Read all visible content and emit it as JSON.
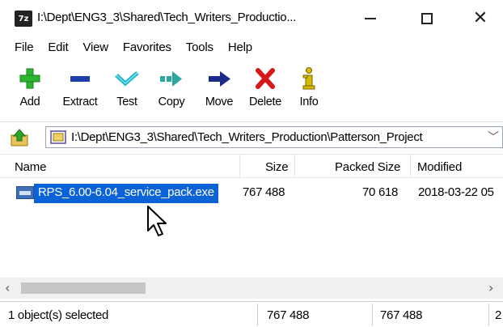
{
  "window": {
    "app_icon_text": "7z",
    "title": "I:\\Dept\\ENG3_3\\Shared\\Tech_Writers_Productio...",
    "minimize_icon": "minimize-icon",
    "maximize_icon": "maximize-icon",
    "close_icon": "close-icon"
  },
  "menu": {
    "items": [
      {
        "label": "File"
      },
      {
        "label": "Edit"
      },
      {
        "label": "View"
      },
      {
        "label": "Favorites"
      },
      {
        "label": "Tools"
      },
      {
        "label": "Help"
      }
    ]
  },
  "toolbar": {
    "buttons": [
      {
        "label": "Add",
        "icon": "plus-icon",
        "color": "#2db52d"
      },
      {
        "label": "Extract",
        "icon": "minus-icon",
        "color": "#1f3fa8"
      },
      {
        "label": "Test",
        "icon": "check-icon",
        "color": "#1ab3c8"
      },
      {
        "label": "Copy",
        "icon": "copy-arrow-icon",
        "color": "#2aa7a0"
      },
      {
        "label": "Move",
        "icon": "move-arrow-icon",
        "color": "#1c2a8c"
      },
      {
        "label": "Delete",
        "icon": "delete-x-icon",
        "color": "#d61818"
      },
      {
        "label": "Info",
        "icon": "info-icon",
        "color": "#d9b800"
      }
    ]
  },
  "address": {
    "path": "I:\\Dept\\ENG3_3\\Shared\\Tech_Writers_Production\\Patterson_Project"
  },
  "columns": {
    "name": "Name",
    "size": "Size",
    "packed_size": "Packed Size",
    "modified": "Modified"
  },
  "rows": [
    {
      "name": "RPS_6.00-6.04_service_pack.exe",
      "size": "767 488",
      "packed_size": "70 618",
      "modified": "2018-03-22 05"
    }
  ],
  "status": {
    "selected": "1 object(s) selected",
    "size": "767 488",
    "packed": "767 488",
    "extra": "2"
  },
  "colors": {
    "selection": "#0c63d8",
    "accent_blue": "#3f6fb6"
  }
}
